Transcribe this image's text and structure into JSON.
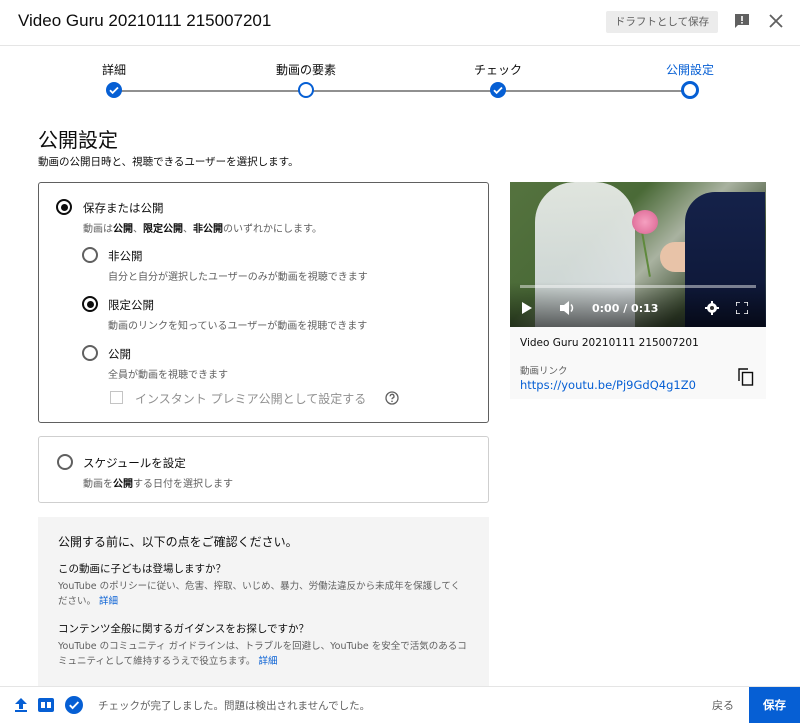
{
  "header": {
    "title": "Video Guru 20210111 215007201",
    "draft_button": "ドラフトとして保存"
  },
  "steps": [
    {
      "label": "詳細",
      "state": "done"
    },
    {
      "label": "動画の要素",
      "state": "current"
    },
    {
      "label": "チェック",
      "state": "done"
    },
    {
      "label": "公開設定",
      "state": "active"
    }
  ],
  "section": {
    "title": "公開設定",
    "description": "動画の公開日時と、視聴できるユーザーを選択します。"
  },
  "visibility": {
    "main_label": "保存または公開",
    "main_sub_prefix": "動画は",
    "main_sub_opt1": "公開",
    "main_sub_sep1": "、",
    "main_sub_opt2": "限定公開",
    "main_sub_sep2": "、",
    "main_sub_opt3": "非公開",
    "main_sub_suffix": "のいずれかにします。",
    "options": [
      {
        "label": "非公開",
        "description": "自分と自分が選択したユーザーのみが動画を視聴できます",
        "selected": false
      },
      {
        "label": "限定公開",
        "description": "動画のリンクを知っているユーザーが動画を視聴できます",
        "selected": true
      },
      {
        "label": "公開",
        "description": "全員が動画を視聴できます",
        "selected": false
      }
    ],
    "premiere_label": "インスタント プレミア公開として設定する"
  },
  "schedule": {
    "label": "スケジュールを設定",
    "sub_prefix": "動画を",
    "sub_bold": "公開",
    "sub_suffix": "する日付を選択します"
  },
  "checklist": {
    "heading": "公開する前に、以下の点をご確認ください。",
    "q1": "この動画に子どもは登場しますか？",
    "p1": "YouTube のポリシーに従い、危害、搾取、いじめ、暴力、労働法違反から未成年を保護してください。",
    "p1_link": "詳細",
    "q2": "コンテンツ全般に関するガイダンスをお探しですか？",
    "p2": "YouTube のコミュニティ ガイドラインは、トラブルを回避し、YouTube を安全で活気のあるコミュニティとして維持するうえで役立ちます。",
    "p2_link": "詳細"
  },
  "preview": {
    "time": "0:00 / 0:13",
    "video_title": "Video Guru 20210111 215007201",
    "link_label": "動画リンク",
    "link": "https://youtu.be/Pj9GdQ4g1Z0"
  },
  "footer": {
    "status": "チェックが完了しました。問題は検出されませんでした。",
    "back_button": "戻る",
    "save_button": "保存"
  },
  "colors": {
    "accent": "#065fd4",
    "text": "#0d0d0d",
    "secondary": "#606060"
  }
}
